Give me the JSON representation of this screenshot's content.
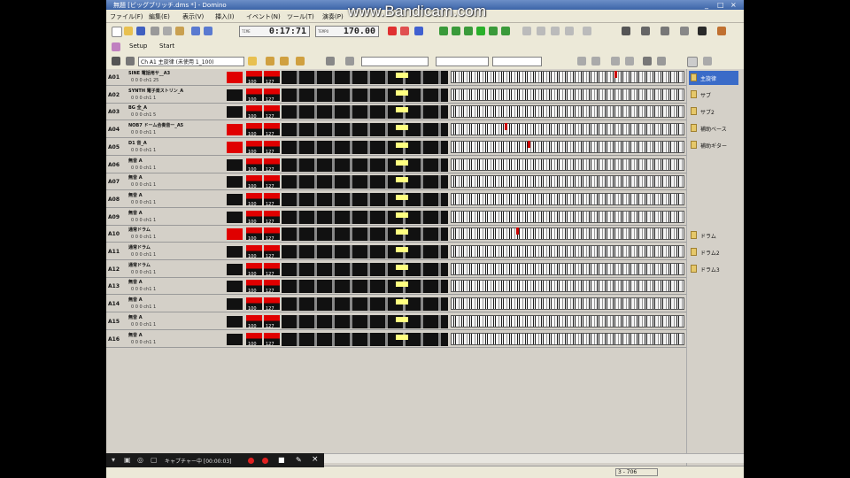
{
  "app": {
    "title": "無題 [ビッグブリッチ.dms *] - Domino",
    "watermark": "www.Bandicam.com",
    "window_controls": [
      "_",
      "□",
      "×"
    ]
  },
  "menu": [
    "ファイル(F)",
    "編集(E)",
    "表示(V)",
    "挿入(I)",
    "イベント(N)",
    "ツール(T)",
    "演奏(P)"
  ],
  "toolbar": {
    "time_label": "TIME",
    "time_value": "0:17:71",
    "tempo_label": "TEMPO",
    "tempo_value": "170.00",
    "setup_label": "Setup",
    "start_label": "Start",
    "port_select": "Ch A1 主旋律 (未使用 1_100)"
  },
  "tracks": [
    {
      "num": "A01",
      "name": "SINE 電話用サ__A3",
      "sub": "0  0  0  ch1  25",
      "swatch": "#e00000",
      "v1": "100",
      "v2": "127",
      "mark": 0.7
    },
    {
      "num": "A02",
      "name": "SYNTH 電子楽ストリン_A",
      "sub": "0  0  0  ch1  1",
      "swatch": "#111111",
      "v1": "100",
      "v2": "127",
      "mark": null
    },
    {
      "num": "A03",
      "name": "BG 全_A",
      "sub": "0  0  0  ch1  5",
      "swatch": "#111111",
      "v1": "100",
      "v2": "127",
      "mark": null
    },
    {
      "num": "A04",
      "name": "NOB7 ドーム合奏音ー_A5",
      "sub": "0  0  0  ch1  1",
      "swatch": "#e00000",
      "v1": "100",
      "v2": "127",
      "mark": 0.23
    },
    {
      "num": "A05",
      "name": "D1 音_A",
      "sub": "0  0  0  ch1  1",
      "swatch": "#e00000",
      "v1": "100",
      "v2": "127",
      "mark": 0.33
    },
    {
      "num": "A06",
      "name": "無音  A",
      "sub": "0  0  0  ch1  1",
      "swatch": "#111111",
      "v1": "100",
      "v2": "127",
      "mark": null
    },
    {
      "num": "A07",
      "name": "無音  A",
      "sub": "0  0  0  ch1  1",
      "swatch": "#111111",
      "v1": "100",
      "v2": "127",
      "mark": null
    },
    {
      "num": "A08",
      "name": "無音  A",
      "sub": "0  0  0  ch1  1",
      "swatch": "#111111",
      "v1": "100",
      "v2": "127",
      "mark": null
    },
    {
      "num": "A09",
      "name": "無音  A",
      "sub": "0  0  0  ch1  1",
      "swatch": "#111111",
      "v1": "100",
      "v2": "127",
      "mark": null
    },
    {
      "num": "A10",
      "name": "通常ドラム",
      "sub": "0  0  0  ch1  1",
      "swatch": "#e00000",
      "v1": "100",
      "v2": "127",
      "mark": 0.28
    },
    {
      "num": "A11",
      "name": "通常ドラム",
      "sub": "0  0  0  ch1  1",
      "swatch": "#111111",
      "v1": "100",
      "v2": "127",
      "mark": null
    },
    {
      "num": "A12",
      "name": "通常ドラム",
      "sub": "0  0  0  ch1  1",
      "swatch": "#111111",
      "v1": "100",
      "v2": "127",
      "mark": null
    },
    {
      "num": "A13",
      "name": "無音  A",
      "sub": "0  0  0  ch1  1",
      "swatch": "#111111",
      "v1": "100",
      "v2": "127",
      "mark": null
    },
    {
      "num": "A14",
      "name": "無音  A",
      "sub": "0  0  0  ch1  1",
      "swatch": "#111111",
      "v1": "100",
      "v2": "127",
      "mark": null
    },
    {
      "num": "A15",
      "name": "無音  A",
      "sub": "0  0  0  ch1  1",
      "swatch": "#111111",
      "v1": "100",
      "v2": "127",
      "mark": null
    },
    {
      "num": "A16",
      "name": "無音  A",
      "sub": "0  0  0  ch1  1",
      "swatch": "#111111",
      "v1": "100",
      "v2": "127",
      "mark": null
    }
  ],
  "side_panel": [
    {
      "label": "主旋律",
      "active": true
    },
    {
      "label": "サブ",
      "active": false
    },
    {
      "label": "サブ2",
      "active": false
    },
    {
      "label": "補助ベース",
      "active": false
    },
    {
      "label": "補助ギター",
      "active": false
    },
    {
      "label": "ドラム",
      "active": false
    },
    {
      "label": "ドラム2",
      "active": false
    },
    {
      "label": "ドラム3",
      "active": false
    }
  ],
  "recorder": {
    "text": "キャプチャー中 [00:00:03]"
  },
  "status": {
    "position": "3 - 706"
  },
  "colors": {
    "title_bar": "#3c64a8",
    "window_bg": "#d4d0c8",
    "active_track": "#e00000",
    "knob": "#ffff80",
    "selected": "#3a6bc8"
  }
}
